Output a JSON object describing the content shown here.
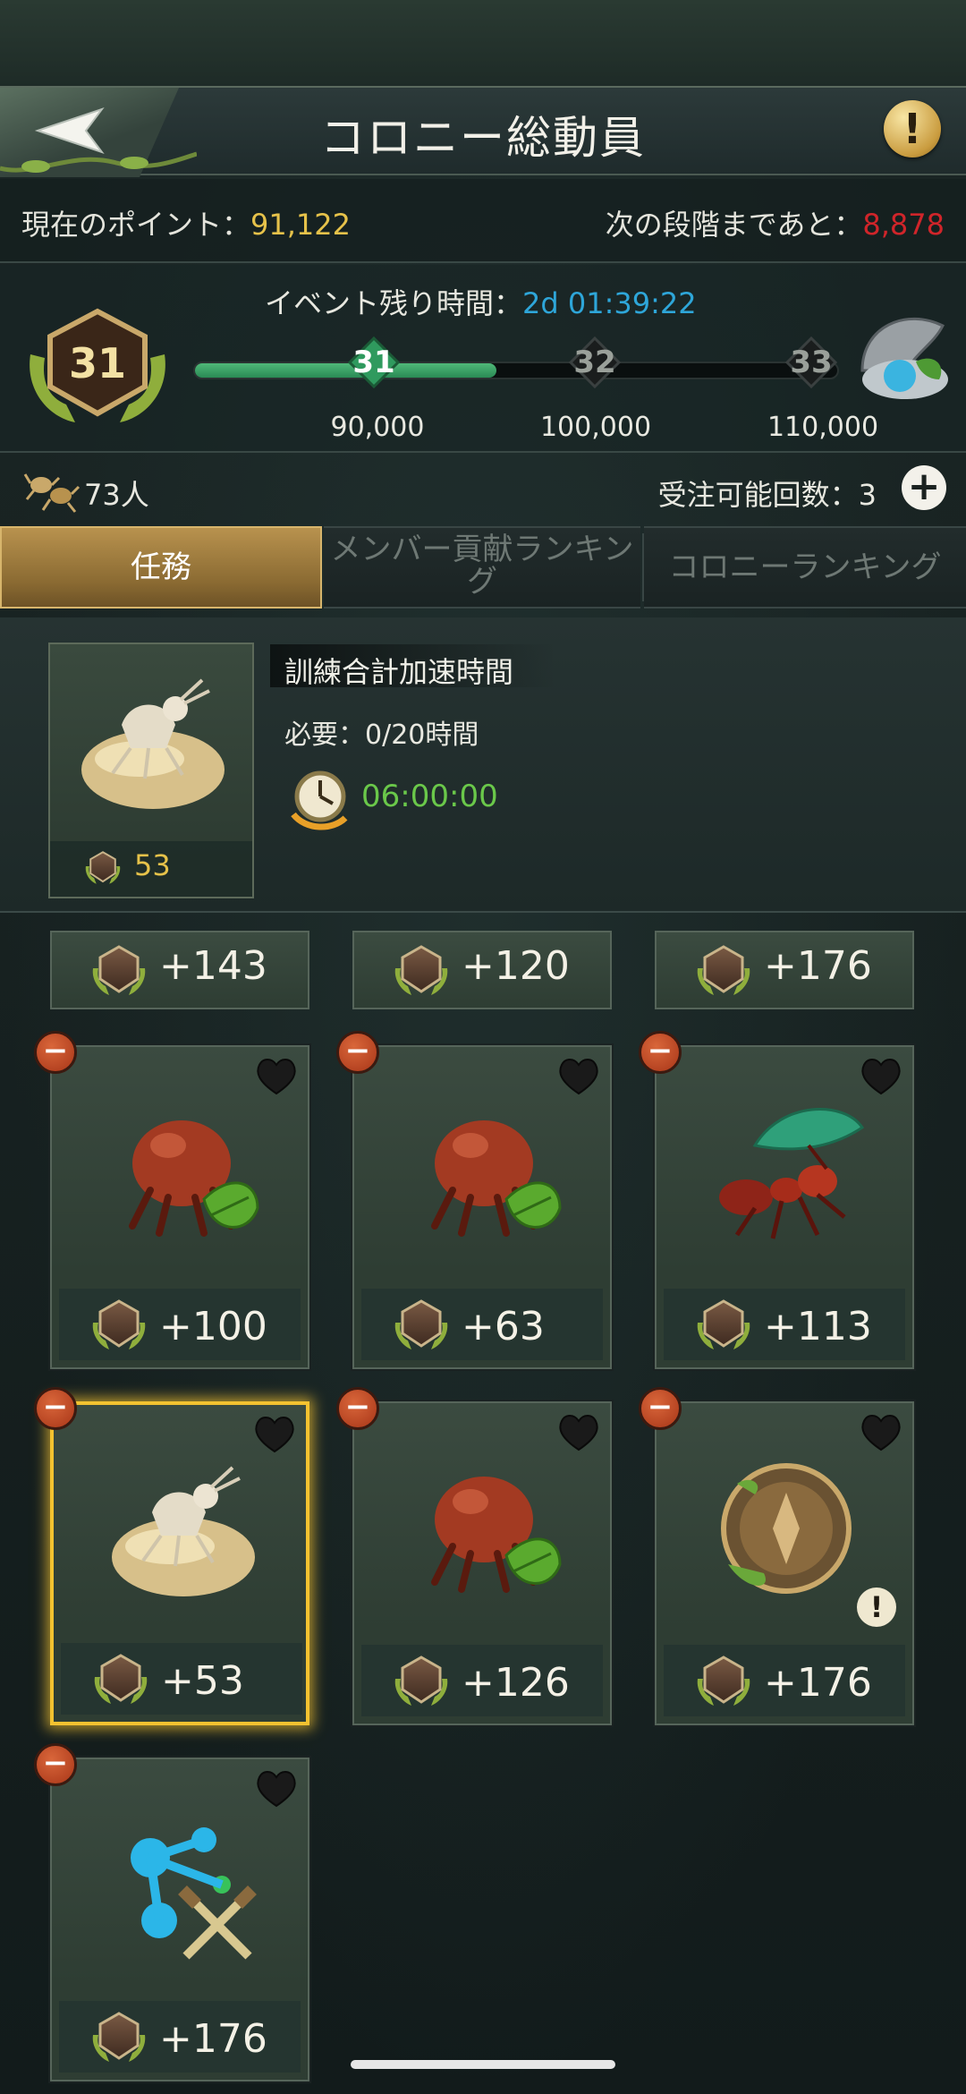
{
  "header": {
    "title": "コロニー総動員",
    "info_label": "!"
  },
  "points": {
    "current_label": "現在のポイント：",
    "current_value": "91,122",
    "next_label": "次の段階まであと：",
    "next_value": "8,878"
  },
  "event": {
    "time_label": "イベント残り時間：",
    "time_value": "2d 01:39:22",
    "level": "31",
    "progress_fraction": 0.47,
    "nodes": [
      {
        "level": "31",
        "threshold": "90,000",
        "reached": true
      },
      {
        "level": "32",
        "threshold": "100,000",
        "reached": false
      },
      {
        "level": "33",
        "threshold": "110,000",
        "reached": false
      }
    ]
  },
  "members": {
    "count": "73人",
    "orders_label": "受注可能回数：3",
    "plus": "+"
  },
  "tabs": [
    {
      "label": "任務",
      "active": true
    },
    {
      "label": "メンバー貢献ランキング",
      "active": false
    },
    {
      "label": "コロニーランキング",
      "active": false
    }
  ],
  "mission": {
    "name": "訓練合計加速時間",
    "requirement": "必要：0/20時間",
    "time": "06:00:00",
    "points": "53"
  },
  "top_row": [
    "+143",
    "+120",
    "+176"
  ],
  "items": [
    {
      "points": "+100",
      "icon": "red-ant-leaf-icon",
      "selected": false
    },
    {
      "points": "+63",
      "icon": "red-ant-leaf-icon",
      "selected": false
    },
    {
      "points": "+113",
      "icon": "leafcutter-ant-icon",
      "selected": false
    },
    {
      "points": "+53",
      "icon": "ant-egg-icon",
      "selected": true
    },
    {
      "points": "+126",
      "icon": "red-ant-leaf-icon",
      "selected": false
    },
    {
      "points": "+176",
      "icon": "bronze-medal-icon",
      "selected": false,
      "warning": "!"
    },
    {
      "points": "+176",
      "icon": "blue-molecule-swords-icon",
      "selected": false
    }
  ],
  "colors": {
    "gold_value": "#e6c24a",
    "red_value": "#d0252a",
    "blue_time": "#2ea6d9",
    "green_time": "#6ac84a",
    "selected_border": "#f3c230"
  }
}
